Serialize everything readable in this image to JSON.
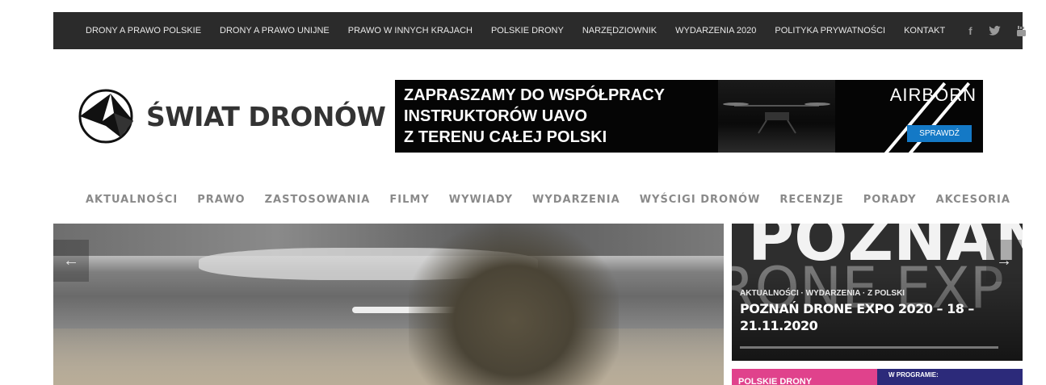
{
  "topbar": {
    "nav": [
      "DRONY A PRAWO POLSKIE",
      "DRONY A PRAWO UNIJNE",
      "PRAWO W INNYCH KRAJACH",
      "POLSKIE DRONY",
      "NARZĘDZIOWNIK",
      "WYDARZENIA 2020",
      "POLITYKA PRYWATNOŚCI",
      "KONTAKT"
    ],
    "social": {
      "facebook": "f",
      "twitter": "🐦",
      "youtube": "▶"
    }
  },
  "logo": {
    "title": "ŚWIAT DRONÓW",
    "icon": "drone-logo-icon"
  },
  "banner": {
    "lines": [
      "ZAPRASZAMY DO WSPÓŁPRACY",
      "INSTRUKTORÓW UAVO",
      "Z TERENU CAŁEJ POLSKI"
    ],
    "brand": "AIRBORN",
    "cta": "SPRAWDŹ"
  },
  "mainnav": [
    "AKTUALNOŚCI",
    "PRAWO",
    "ZASTOSOWANIA",
    "FILMY",
    "WYWIADY",
    "WYDARZENIA",
    "WYŚCIGI DRONÓW",
    "RECENZJE",
    "PORADY",
    "AKCESORIA"
  ],
  "slider": {
    "prev_icon": "arrow-left-icon",
    "next_icon": "arrow-right-icon"
  },
  "side_card": {
    "bg_text_1": "POZNAN",
    "bg_text_2": "RONE EXP",
    "categories": "AKTUALNOŚCI · WYDARZENIA · Z POLSKI",
    "headline": "POZNAŃ DRONE EXPO 2020 – 18 – 21.11.2020"
  },
  "side_card_2": {
    "label": "POLSKIE DRONY",
    "program": "W PROGRAMIE:"
  }
}
